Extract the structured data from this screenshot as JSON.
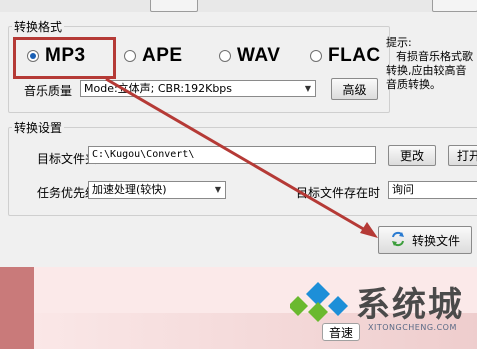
{
  "format_group": {
    "title": "转换格式",
    "options": [
      {
        "label": "MP3",
        "selected": true
      },
      {
        "label": "APE",
        "selected": false
      },
      {
        "label": "WAV",
        "selected": false
      },
      {
        "label": "FLAC",
        "selected": false
      }
    ],
    "quality_label": "音乐质量",
    "quality_value": "Mode:立体声; CBR:192Kbps",
    "advanced_button": "高级",
    "hint_lines": [
      "提示:",
      "有损音乐格式歌",
      "转换,应由较高音",
      "音质转换。"
    ]
  },
  "settings_group": {
    "title": "转换设置",
    "target_folder_label": "目标文件夹",
    "target_folder_value": "C:\\Kugou\\Convert\\",
    "change_button": "更改",
    "open_button": "打开",
    "priority_label": "任务优先级",
    "priority_value": "加速处理(较快)",
    "exists_label": "目标文件存在时",
    "exists_value": "询问"
  },
  "convert_button": "转换文件",
  "watermark": {
    "title": "系统城",
    "subtitle": "XITONGCHENG.COM"
  },
  "speed_button": "音速",
  "colors": {
    "annotation": "#b53a36",
    "watermark_blue": "#1d8fd8",
    "watermark_green": "#6ab92f"
  }
}
